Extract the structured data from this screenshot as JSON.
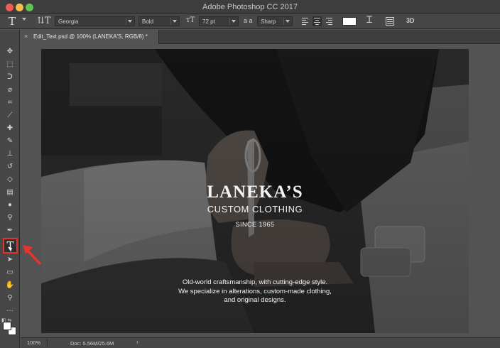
{
  "window": {
    "title": "Adobe Photoshop CC 2017"
  },
  "options_bar": {
    "font_family": "Georgia",
    "font_style": "Bold",
    "font_size": "72 pt",
    "anti_alias_label": "a a",
    "anti_alias": "Sharp",
    "threed_label": "3D",
    "text_color": "#ffffff"
  },
  "document_tab": {
    "close_glyph": "×",
    "label": "Edit_Text.psd @ 100% (LANEKA'S, RGB/8) *"
  },
  "canvas_text": {
    "brand": "LANEKA’S",
    "tagline": "CUSTOM CLOTHING",
    "since": "SINCE 1965",
    "description_line1": "Old-world craftsmanship, with cutting-edge style.",
    "description_line2": "We specialize in alterations, custom-made clothing,",
    "description_line3": "and original designs."
  },
  "status_bar": {
    "zoom": "100%",
    "doc_size": "Doc: 5.56M/25.6M",
    "menu_arrow": "›"
  },
  "toolbar": {
    "active_tool": "type-tool",
    "highlight_color": "#e8322c",
    "tools": [
      "move-tool",
      "marquee-tool",
      "lasso-tool",
      "quick-selection-tool",
      "crop-tool",
      "eyedropper-tool",
      "healing-brush-tool",
      "brush-tool",
      "clone-stamp-tool",
      "history-brush-tool",
      "eraser-tool",
      "gradient-tool",
      "blur-tool",
      "dodge-tool",
      "pen-tool",
      "type-tool",
      "path-selection-tool",
      "rectangle-tool",
      "hand-tool",
      "zoom-tool",
      "more-tools"
    ]
  },
  "annotation": {
    "arrow_color": "#e8322c"
  }
}
